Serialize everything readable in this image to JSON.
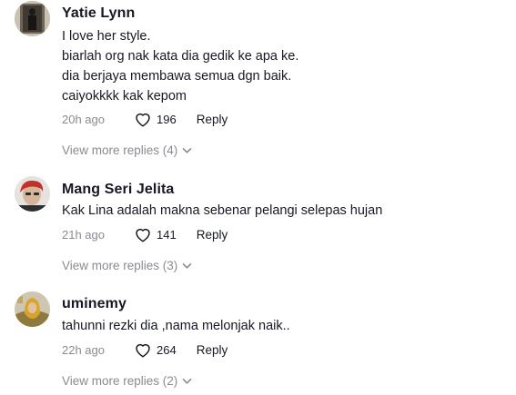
{
  "comments": [
    {
      "username": "Yatie Lynn",
      "lines": [
        "I love her style.",
        "biarlah org nak kata dia gedik ke apa ke.",
        "dia berjaya membawa semua dgn baik.",
        "caiyokkkk kak kepom"
      ],
      "time": "20h ago",
      "likes": "196",
      "reply_label": "Reply",
      "more_replies": "View more replies (4)"
    },
    {
      "username": "Mang Seri Jelita",
      "lines": [
        "Kak Lina adalah makna sebenar pelangi selepas hujan"
      ],
      "time": "21h ago",
      "likes": "141",
      "reply_label": "Reply",
      "more_replies": "View more replies (3)"
    },
    {
      "username": "uminemy",
      "lines": [
        "tahunni rezki dia ,nama melonjak naik.."
      ],
      "time": "22h ago",
      "likes": "264",
      "reply_label": "Reply",
      "more_replies": "View more replies (2)"
    }
  ],
  "icons": {
    "like": "heart-outline-icon",
    "expand": "chevron-down-icon"
  },
  "colors": {
    "text": "#161823",
    "secondary": "#8a8b91"
  }
}
